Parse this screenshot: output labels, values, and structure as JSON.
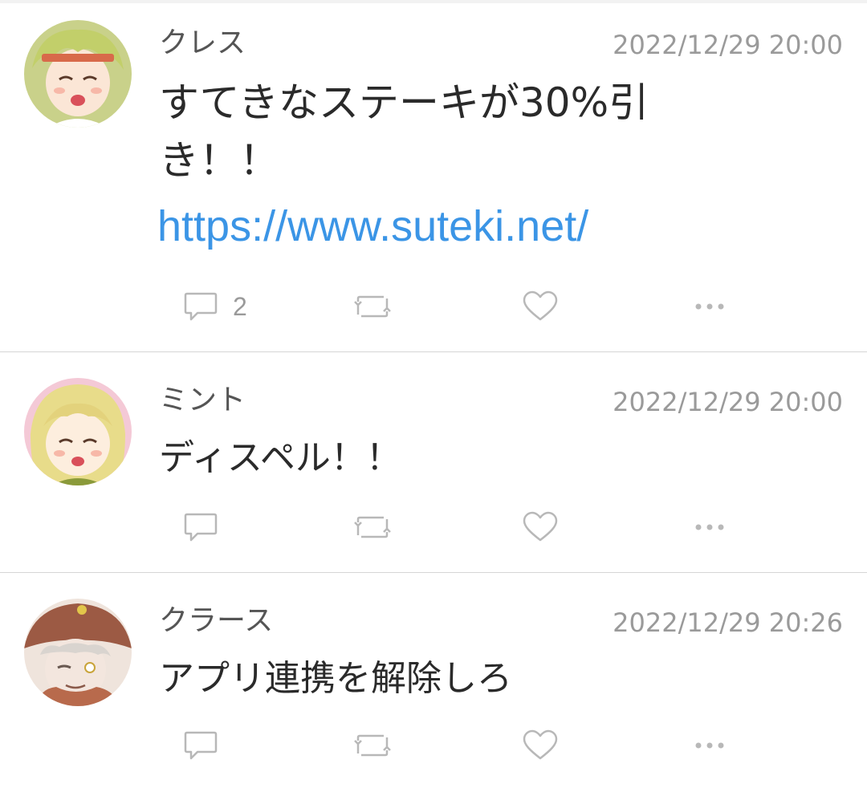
{
  "posts": [
    {
      "author": "クレス",
      "timestamp": "2022/12/29 20:00",
      "text_lines": [
        "すてきなステーキが30%引",
        "き！！"
      ],
      "link": "https://www.suteki.net/",
      "reply_count": "2",
      "avatar": "cress-avatar"
    },
    {
      "author": "ミント",
      "timestamp": "2022/12/29 20:00",
      "text": "ディスペル！！",
      "reply_count": "",
      "avatar": "mint-avatar"
    },
    {
      "author": "クラース",
      "timestamp": "2022/12/29 20:26",
      "text": "アプリ連携を解除しろ",
      "reply_count": "",
      "avatar": "klarth-avatar"
    }
  ],
  "icons": {
    "reply": "speech-bubble-icon",
    "repost": "repost-arrows-icon",
    "like": "heart-icon",
    "more": "more-dots-icon"
  },
  "colors": {
    "link": "#3b95e6",
    "meta": "#9a9a9a",
    "icon": "#b8b8b8",
    "divider": "#d6d6d6"
  }
}
